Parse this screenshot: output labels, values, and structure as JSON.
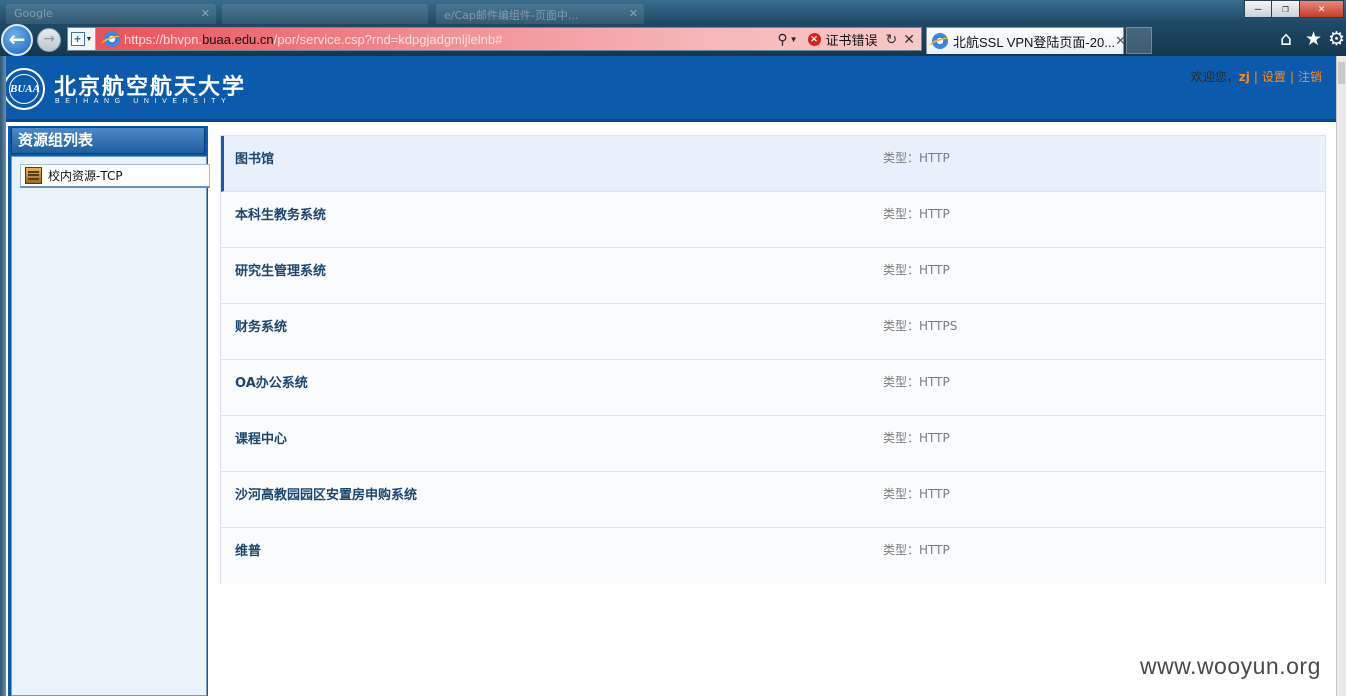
{
  "browser": {
    "ghost_tabs": [
      {
        "label": "Google"
      },
      {
        "label": ""
      },
      {
        "label": "e/Cap邮件编组件-页面中..."
      }
    ],
    "window_controls": {
      "minimize": "–",
      "restore": "❐",
      "close": "✕"
    },
    "back_glyph": "←",
    "forward_glyph": "→",
    "address": {
      "url_prefix": "https://bhvpn.",
      "url_host": "buaa.edu.cn",
      "url_suffix": "/por/service.csp?rnd=kdpgjadgmljlelnb#",
      "search_glyph": "⚲",
      "dropdown_glyph": "▼",
      "cert_error_glyph": "✕",
      "cert_error_text": "证书错误",
      "refresh_glyph": "↻",
      "stop_glyph": "✕"
    },
    "active_tab": {
      "title": "北航SSL VPN登陆页面-20...",
      "close_glyph": "✕"
    },
    "toolbar_icons": {
      "home": "⌂",
      "favorites": "★",
      "tools": "⚙"
    },
    "colors": {
      "address_bar_error": "#ee4a52"
    }
  },
  "header": {
    "seal_text": "BUAA",
    "university_cn": "北京航空航天大学",
    "university_en": "BEIHANG UNIVERSITY",
    "welcome_text": "欢迎您，",
    "user_name": "zj",
    "separator": "|",
    "settings_label": "设置",
    "logout_label": "注销",
    "colors": {
      "header_bg": "#0b5aab",
      "link": "#ff8a1c"
    }
  },
  "sidebar": {
    "title": "资源组列表",
    "groups": [
      {
        "label": "校内资源-TCP"
      }
    ]
  },
  "resources": [
    {
      "name": "图书馆",
      "type": "类型：HTTP"
    },
    {
      "name": "本科生教务系统",
      "type": "类型：HTTP"
    },
    {
      "name": "研究生管理系统",
      "type": "类型：HTTP"
    },
    {
      "name": "财务系统",
      "type": "类型：HTTPS"
    },
    {
      "name": "OA办公系统",
      "type": "类型：HTTP"
    },
    {
      "name": "课程中心",
      "type": "类型：HTTP"
    },
    {
      "name": "沙河高教园园区安置房申购系统",
      "type": "类型：HTTP"
    },
    {
      "name": "维普",
      "type": "类型：HTTP"
    }
  ],
  "watermark": "www.wooyun.org"
}
